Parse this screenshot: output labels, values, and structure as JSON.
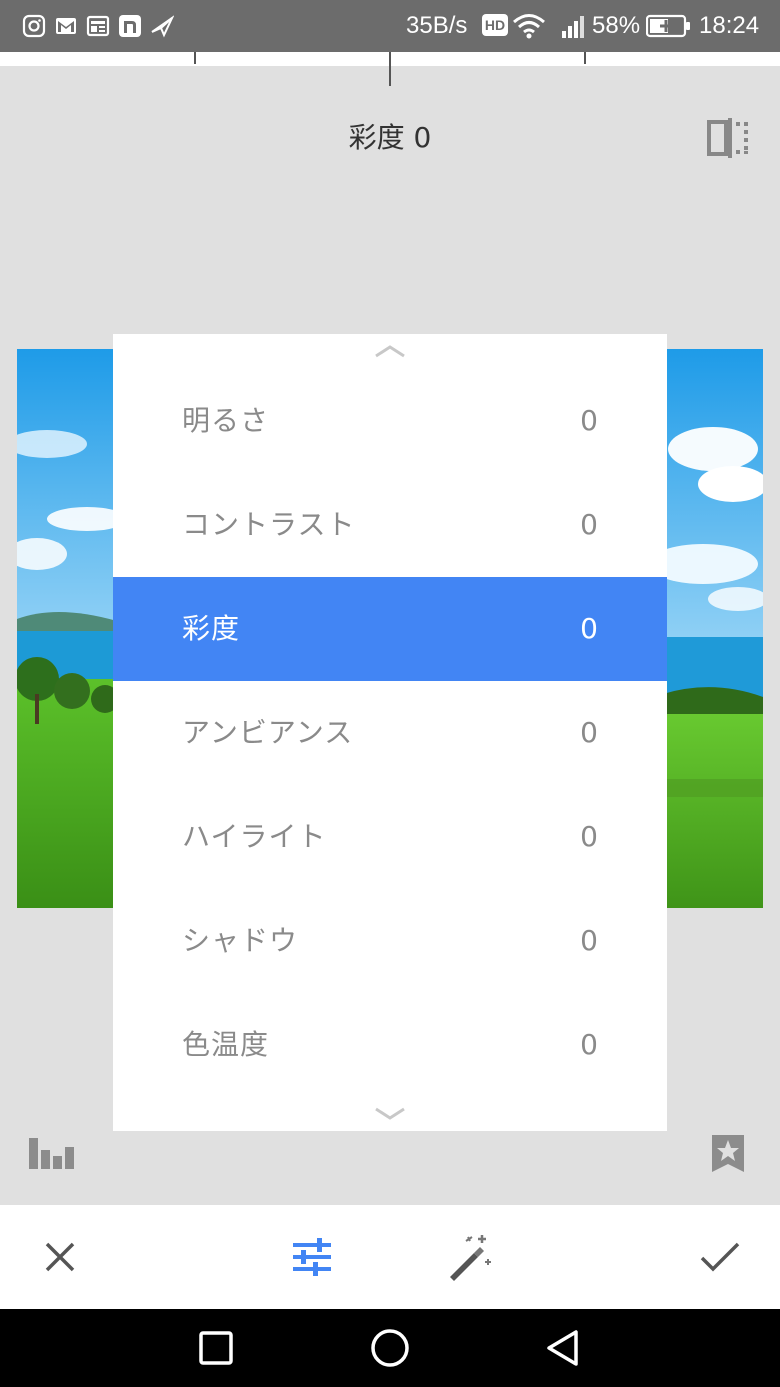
{
  "status_bar": {
    "notification_icons": [
      "instagram-icon",
      "gmail-icon",
      "news-icon",
      "notes-icon",
      "send-icon"
    ],
    "net_speed": "35B/s",
    "hd_badge": "HD",
    "battery_percent": "58%",
    "time": "18:24"
  },
  "header": {
    "title": "彩度 0",
    "compare_icon": "compare-split-icon"
  },
  "adjust_menu": {
    "selected_index": 2,
    "accent_color": "#4285f4",
    "items": [
      {
        "label": "明るさ",
        "value": "0"
      },
      {
        "label": "コントラスト",
        "value": "0"
      },
      {
        "label": "彩度",
        "value": "0"
      },
      {
        "label": "アンビアンス",
        "value": "0"
      },
      {
        "label": "ハイライト",
        "value": "0"
      },
      {
        "label": "シャドウ",
        "value": "0"
      },
      {
        "label": "色温度",
        "value": "0"
      }
    ]
  },
  "tools": {
    "histogram_icon": "histogram-icon",
    "styles_icon": "star-bookmark-icon"
  },
  "bottom_bar": {
    "cancel_icon": "close-icon",
    "adjust_icon": "tune-sliders-icon",
    "auto_icon": "magic-wand-icon",
    "apply_icon": "check-icon",
    "active_color": "#4285f4"
  },
  "nav_bar": {
    "recents_icon": "square-icon",
    "home_icon": "circle-icon",
    "back_icon": "triangle-back-icon"
  }
}
